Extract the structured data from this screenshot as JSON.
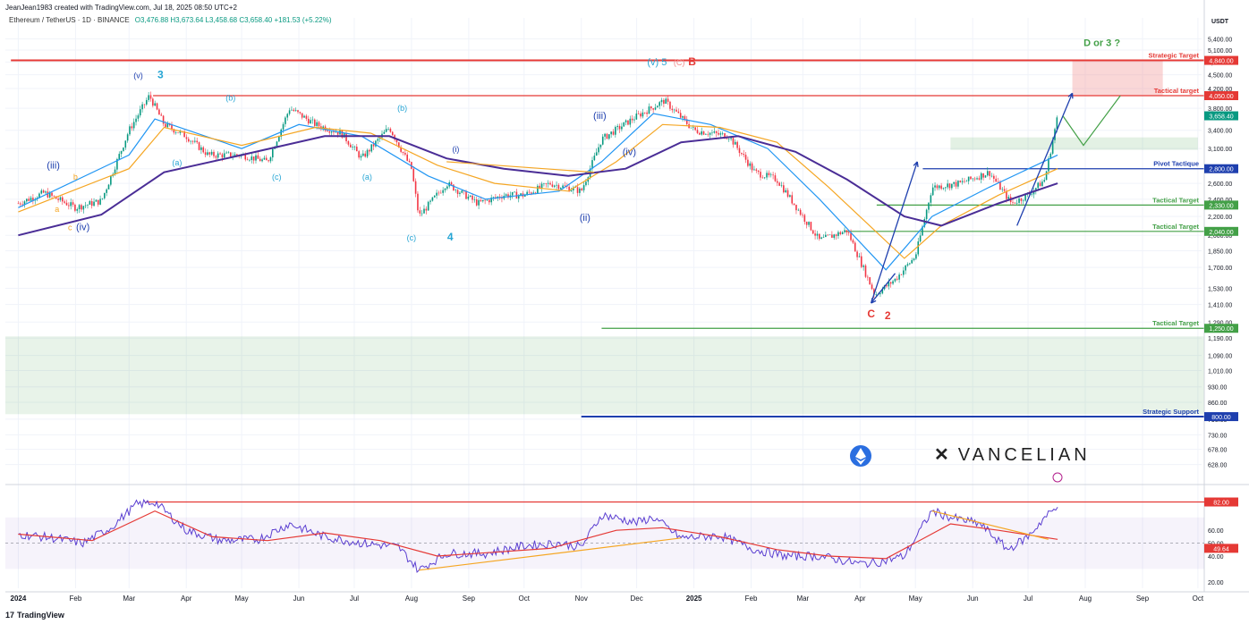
{
  "header": {
    "created_by": "JeanJean1983 created with TradingView.com, Jul 18, 2025 08:50 UTC+2",
    "symbol": "Ethereum / TetherUS · 1D · BINANCE",
    "ohlc": "O3,476.88 H3,673.64 L3,458.68 C3,658.40 +181.53 (+5.22%)"
  },
  "footer": {
    "logo_mark": "17",
    "logo_text": "TradingView"
  },
  "brand": {
    "name": "VANCELIAN",
    "mark": "✕"
  },
  "colors": {
    "up": "#089981",
    "down": "#f23645",
    "ema_fast": "#2196f3",
    "ema_mid": "#f5a623",
    "ema_slow": "#4a2d96",
    "rsi": "#5b3fd1",
    "rsi_ma": "#e53935",
    "target_red": "#e53935",
    "target_green": "#43a047",
    "pivot_blue": "#1e3fae"
  },
  "chart_data": [
    {
      "type": "line",
      "title": "Ethereum / TetherUS · 1D · BINANCE",
      "yscale": "log",
      "ylabel": "USDT",
      "ylim": [
        578,
        6000
      ],
      "x_ticks": [
        "2024",
        "Feb",
        "Mar",
        "Apr",
        "May",
        "Jun",
        "Jul",
        "Aug",
        "Sep",
        "Oct",
        "Nov",
        "Dec",
        "2025",
        "Feb",
        "Mar",
        "Apr",
        "May",
        "Jun",
        "Jul",
        "Aug",
        "Sep",
        "Oct"
      ],
      "y_ticks": [
        "5,400.00",
        "5,100.00",
        "4,800.00",
        "4,500.00",
        "4,200.00",
        "3,800.00",
        "3,400.00",
        "3,100.00",
        "2,800.00",
        "2,600.00",
        "2,400.00",
        "2,200.00",
        "2,000.00",
        "1,850.00",
        "1,700.00",
        "1,530.00",
        "1,410.00",
        "1,290.00",
        "1,190.00",
        "1,090.00",
        "1,010.00",
        "930.00",
        "860.00",
        "790.00",
        "730.00",
        "678.00",
        "628.00"
      ],
      "series": [
        {
          "name": "",
          "role": "close",
          "x": [
            "2024-01-01",
            "2024-01-15",
            "2024-02-01",
            "2024-02-15",
            "2024-03-01",
            "2024-03-12",
            "2024-03-20",
            "2024-04-01",
            "2024-04-13",
            "2024-05-01",
            "2024-05-15",
            "2024-05-27",
            "2024-06-10",
            "2024-06-24",
            "2024-07-05",
            "2024-07-20",
            "2024-08-01",
            "2024-08-05",
            "2024-08-20",
            "2024-09-06",
            "2024-09-20",
            "2024-10-01",
            "2024-10-15",
            "2024-11-01",
            "2024-11-12",
            "2024-12-01",
            "2024-12-16",
            "2025-01-01",
            "2025-01-20",
            "2025-02-03",
            "2025-02-15",
            "2025-03-01",
            "2025-03-10",
            "2025-03-25",
            "2025-04-09",
            "2025-04-20",
            "2025-05-01",
            "2025-05-10",
            "2025-05-25",
            "2025-06-10",
            "2025-06-22",
            "2025-07-01",
            "2025-07-10",
            "2025-07-17"
          ],
          "values": [
            2350,
            2480,
            2300,
            2380,
            3400,
            4050,
            3500,
            3300,
            3000,
            3000,
            2900,
            3800,
            3500,
            3350,
            2950,
            3450,
            2800,
            2200,
            2600,
            2350,
            2450,
            2450,
            2600,
            2500,
            3250,
            3650,
            3950,
            3400,
            3300,
            2750,
            2650,
            2200,
            1950,
            2050,
            1480,
            1600,
            1800,
            2550,
            2600,
            2750,
            2350,
            2450,
            2650,
            3650
          ]
        },
        {
          "name": "",
          "role": "ema-fast",
          "x": [
            "2024-01-01",
            "2024-03-01",
            "2024-03-15",
            "2024-05-01",
            "2024-06-01",
            "2024-07-05",
            "2024-08-10",
            "2024-09-10",
            "2024-10-20",
            "2024-11-12",
            "2024-12-10",
            "2025-01-10",
            "2025-02-10",
            "2025-03-10",
            "2025-04-15",
            "2025-05-10",
            "2025-06-10",
            "2025-07-17"
          ],
          "values": [
            2300,
            3000,
            3600,
            3100,
            3500,
            3300,
            2700,
            2400,
            2500,
            2900,
            3700,
            3500,
            3100,
            2400,
            1680,
            2200,
            2550,
            3000
          ]
        },
        {
          "name": "",
          "role": "ema-mid",
          "x": [
            "2024-01-01",
            "2024-03-01",
            "2024-03-20",
            "2024-05-01",
            "2024-06-10",
            "2024-07-10",
            "2024-08-15",
            "2024-09-15",
            "2024-10-25",
            "2024-11-20",
            "2024-12-15",
            "2025-01-15",
            "2025-02-15",
            "2025-03-15",
            "2025-04-25",
            "2025-05-15",
            "2025-06-15",
            "2025-07-17"
          ],
          "values": [
            2250,
            2800,
            3450,
            3150,
            3450,
            3350,
            2850,
            2600,
            2500,
            2900,
            3500,
            3450,
            3200,
            2550,
            1780,
            2100,
            2450,
            2800
          ]
        },
        {
          "name": "",
          "role": "ema-slow",
          "x": [
            "2024-01-01",
            "2024-02-15",
            "2024-03-20",
            "2024-05-01",
            "2024-06-15",
            "2024-07-20",
            "2024-08-20",
            "2024-09-20",
            "2024-10-25",
            "2024-11-25",
            "2024-12-25",
            "2025-01-25",
            "2025-02-25",
            "2025-03-25",
            "2025-04-25",
            "2025-05-15",
            "2025-06-15",
            "2025-07-17"
          ],
          "values": [
            2000,
            2220,
            2750,
            3000,
            3300,
            3300,
            2950,
            2800,
            2700,
            2800,
            3200,
            3300,
            3050,
            2650,
            2200,
            2100,
            2350,
            2600
          ]
        }
      ],
      "horizontal_levels": [
        {
          "label": "Strategic Target",
          "value": 4840,
          "tag": "4,840.00",
          "color": "#e53935"
        },
        {
          "label": "Tactical target",
          "value": 4050,
          "tag": "4,050.00",
          "color": "#e53935"
        },
        {
          "label": "Pivot Tactique",
          "value": 2800,
          "tag": "2,800.00",
          "color": "#1e3fae"
        },
        {
          "label": "Tactical Target",
          "value": 2330,
          "tag": "2,330.00",
          "color": "#43a047"
        },
        {
          "label": "Tactical Target",
          "value": 2040,
          "tag": "2,040.00",
          "color": "#43a047"
        },
        {
          "label": "Tactical Target",
          "value": 1250,
          "tag": "1,250.00",
          "color": "#43a047"
        },
        {
          "label": "Strategic Support",
          "value": 800,
          "tag": "800.00",
          "color": "#1e3fae"
        }
      ],
      "current_price_tag": "3,658.40",
      "annotations": [
        {
          "text": "(iii)",
          "x": "2024-01-20",
          "y": 2800,
          "color": "#1e3fae"
        },
        {
          "text": "b",
          "x": "2024-02-01",
          "y": 2650,
          "color": "#f5a623"
        },
        {
          "text": "a",
          "x": "2024-01-22",
          "y": 2250,
          "color": "#f5a623"
        },
        {
          "text": "c",
          "x": "2024-01-29",
          "y": 2050,
          "color": "#f5a623"
        },
        {
          "text": "(iv)",
          "x": "2024-02-05",
          "y": 2050,
          "color": "#1e3fae"
        },
        {
          "text": "(v)",
          "x": "2024-03-06",
          "y": 4420,
          "color": "#1e3fae"
        },
        {
          "text": "3",
          "x": "2024-03-18",
          "y": 4420,
          "color": "#26a5d4"
        },
        {
          "text": "(b)",
          "x": "2024-04-25",
          "y": 3950,
          "color": "#26a5d4"
        },
        {
          "text": "(a)",
          "x": "2024-03-27",
          "y": 2850,
          "color": "#26a5d4"
        },
        {
          "text": "(c)",
          "x": "2024-05-20",
          "y": 2650,
          "color": "#26a5d4"
        },
        {
          "text": "(b)",
          "x": "2024-07-27",
          "y": 3750,
          "color": "#26a5d4"
        },
        {
          "text": "(a)",
          "x": "2024-07-08",
          "y": 2650,
          "color": "#26a5d4"
        },
        {
          "text": "(c)",
          "x": "2024-08-01",
          "y": 1950,
          "color": "#26a5d4"
        },
        {
          "text": "4",
          "x": "2024-08-22",
          "y": 1950,
          "color": "#26a5d4"
        },
        {
          "text": "(i)",
          "x": "2024-08-25",
          "y": 3050,
          "color": "#1e3fae"
        },
        {
          "text": "(iii)",
          "x": "2024-11-11",
          "y": 3600,
          "color": "#1e3fae"
        },
        {
          "text": "(ii)",
          "x": "2024-11-03",
          "y": 2150,
          "color": "#1e3fae"
        },
        {
          "text": "(iv)",
          "x": "2024-11-27",
          "y": 3000,
          "color": "#1e3fae"
        },
        {
          "text": "(v) 5",
          "x": "2024-12-12",
          "y": 4720,
          "color": "#26a5d4"
        },
        {
          "text": "(C)",
          "x": "2024-12-24",
          "y": 4720,
          "color": "#f28b8b"
        },
        {
          "text": "B",
          "x": "2024-12-31",
          "y": 4720,
          "color": "#e53935"
        },
        {
          "text": "C",
          "x": "2025-04-07",
          "y": 1320,
          "color": "#e53935"
        },
        {
          "text": "2",
          "x": "2025-04-16",
          "y": 1310,
          "color": "#e53935"
        },
        {
          "text": "D or 3 ?",
          "x": "2025-08-10",
          "y": 5200,
          "color": "#43a047"
        }
      ]
    },
    {
      "type": "line",
      "title": "",
      "ylim": [
        15,
        90
      ],
      "y_ticks": [
        "82.00",
        "60.00",
        "50.00",
        "40.00",
        "20.00"
      ],
      "levels": [
        82,
        50
      ],
      "series": [
        {
          "name": "",
          "role": "rsi",
          "x": [
            "2024-01-01",
            "2024-01-20",
            "2024-02-05",
            "2024-02-20",
            "2024-03-05",
            "2024-03-15",
            "2024-04-01",
            "2024-04-20",
            "2024-05-10",
            "2024-05-27",
            "2024-06-15",
            "2024-07-05",
            "2024-07-25",
            "2024-08-05",
            "2024-08-20",
            "2024-09-10",
            "2024-10-01",
            "2024-10-20",
            "2024-11-01",
            "2024-11-12",
            "2024-12-01",
            "2024-12-10",
            "2024-12-25",
            "2025-01-15",
            "2025-02-03",
            "2025-02-20",
            "2025-03-10",
            "2025-04-01",
            "2025-04-10",
            "2025-04-25",
            "2025-05-10",
            "2025-05-20",
            "2025-06-05",
            "2025-06-20",
            "2025-07-01",
            "2025-07-10",
            "2025-07-17"
          ],
          "values": [
            57,
            54,
            50,
            62,
            80,
            82,
            60,
            52,
            53,
            65,
            55,
            50,
            47,
            29,
            42,
            42,
            48,
            50,
            47,
            72,
            66,
            70,
            54,
            56,
            45,
            40,
            40,
            34,
            35,
            40,
            75,
            70,
            65,
            45,
            55,
            70,
            78
          ]
        },
        {
          "name": "",
          "role": "rsi-ma",
          "x": [
            "2024-01-01",
            "2024-02-10",
            "2024-03-15",
            "2024-04-15",
            "2024-05-15",
            "2024-06-15",
            "2024-07-15",
            "2024-08-15",
            "2024-09-15",
            "2024-10-15",
            "2024-11-20",
            "2024-12-15",
            "2025-01-15",
            "2025-02-15",
            "2025-03-15",
            "2025-04-15",
            "2025-05-20",
            "2025-06-15",
            "2025-07-17"
          ],
          "values": [
            57,
            52,
            75,
            55,
            52,
            58,
            52,
            40,
            43,
            46,
            60,
            62,
            55,
            45,
            40,
            38,
            65,
            60,
            53
          ]
        }
      ],
      "current_value_tags": [
        "49.64"
      ]
    }
  ]
}
